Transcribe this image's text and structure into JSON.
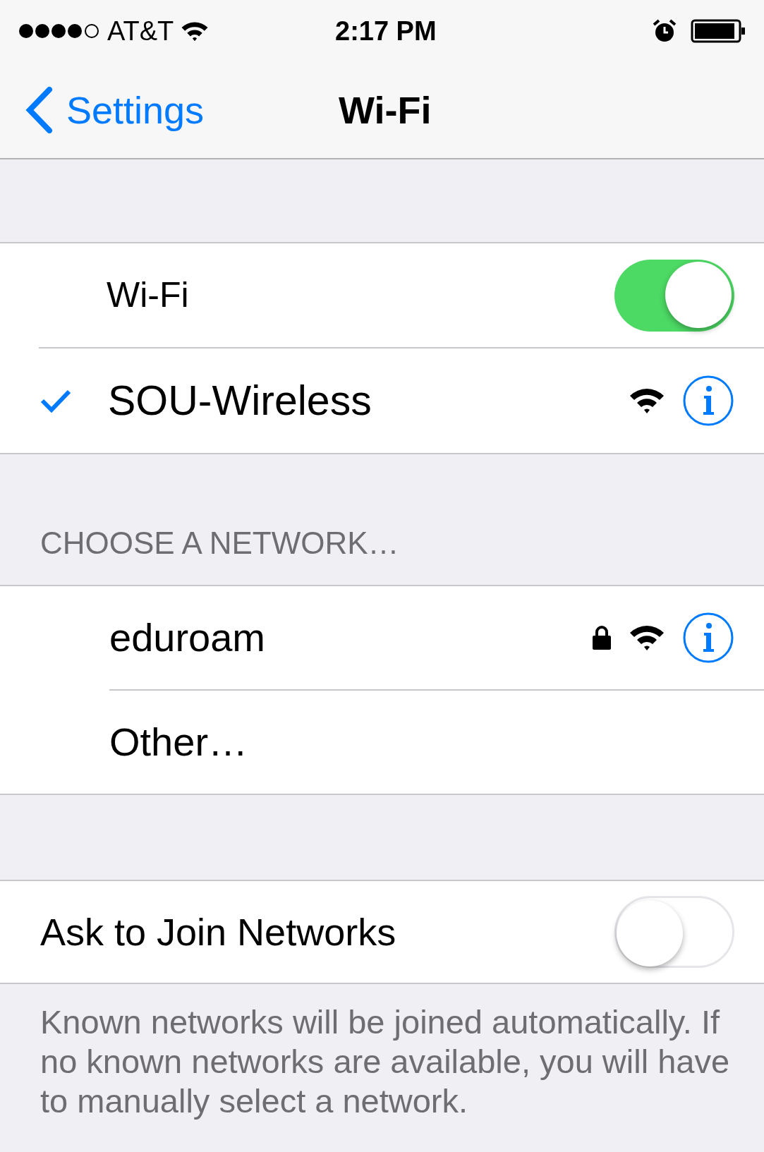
{
  "status_bar": {
    "carrier": "AT&T",
    "time": "2:17 PM"
  },
  "nav_bar": {
    "back_label": "Settings",
    "title": "Wi-Fi"
  },
  "wifi": {
    "label": "Wi-Fi",
    "on": true
  },
  "current_network": {
    "name": "SOU-Wireless",
    "connected": true,
    "locked": false
  },
  "networks_header": "CHOOSE A NETWORK…",
  "networks": [
    {
      "kind": "network",
      "name": "eduroam",
      "locked": true
    },
    {
      "kind": "other",
      "name": "Other…"
    }
  ],
  "ask_to_join": {
    "label": "Ask to Join Networks",
    "on": false
  },
  "footer": "Known networks will be joined automatically. If no known networks are available, you will have to manually select a network."
}
